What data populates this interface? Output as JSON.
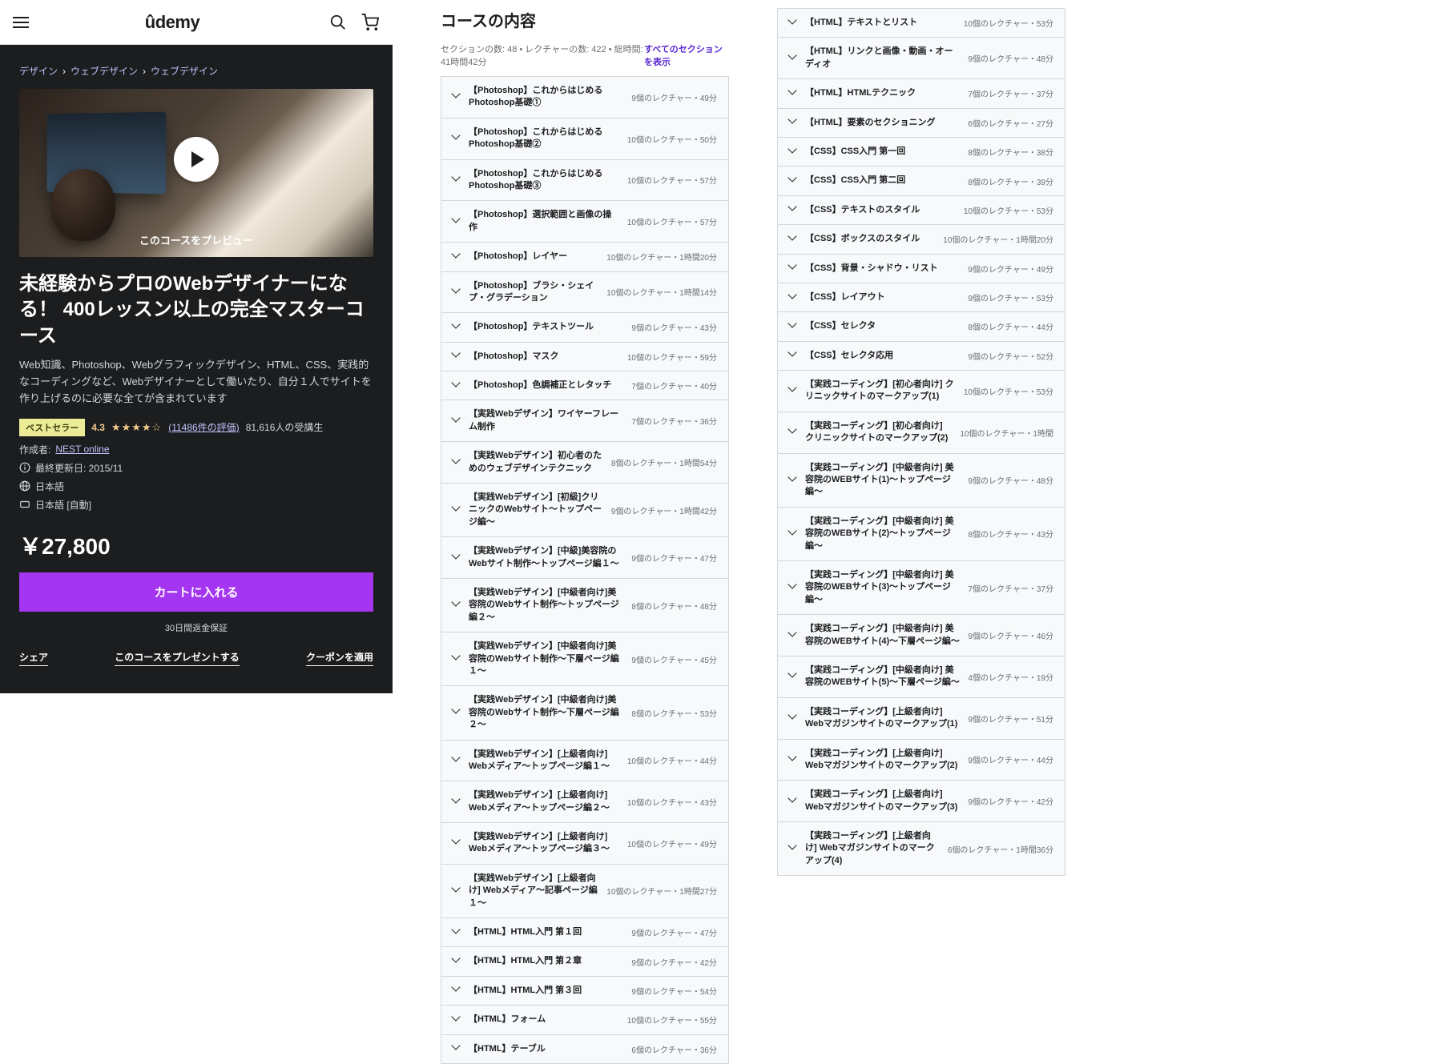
{
  "logo": "ûdemy",
  "breadcrumb": [
    "デザイン",
    "ウェブデザイン",
    "ウェブデザイン"
  ],
  "preview_label": "このコースをプレビュー",
  "title": "未経験からプロのWebデザイナーになる！ 400レッスン以上の完全マスターコース",
  "subtitle": "Web知識、Photoshop、Webグラフィックデザイン、HTML、CSS、実践的なコーディングなど、Webデザイナーとして働いたり、自分１人でサイトを作り上げるのに必要な全てが含まれています",
  "bestseller": "ベストセラー",
  "rating": "4.3",
  "stars": "★★★★☆",
  "reviews": "(11486件の評価)",
  "students": "81,616人の受講生",
  "creator_label": "作成者:",
  "creator": "NEST online",
  "updated": "最終更新日: 2015/11",
  "lang": "日本語",
  "cc": "日本語 [自動]",
  "price": "￥27,800",
  "add_to_cart": "カートに入れる",
  "guarantee": "30日間返金保証",
  "share": "シェア",
  "gift": "このコースをプレゼントする",
  "coupon": "クーポンを適用",
  "cc_title": "コースの内容",
  "cc_stats": "セクションの数: 48 • レクチャーの数: 422 • 総時間: 41時間42分",
  "cc_expand": "すべてのセクションを表示",
  "sections_a": [
    {
      "t": "【Photoshop】これからはじめるPhotoshop基礎①",
      "m": "9個のレクチャー・49分"
    },
    {
      "t": "【Photoshop】これからはじめるPhotoshop基礎②",
      "m": "10個のレクチャー・50分"
    },
    {
      "t": "【Photoshop】これからはじめるPhotoshop基礎③",
      "m": "10個のレクチャー・57分"
    },
    {
      "t": "【Photoshop】選択範囲と画像の操作",
      "m": "10個のレクチャー・57分"
    },
    {
      "t": "【Photoshop】レイヤー",
      "m": "10個のレクチャー・1時間20分"
    },
    {
      "t": "【Photoshop】ブラシ・シェイプ・グラデーション",
      "m": "10個のレクチャー・1時間14分"
    },
    {
      "t": "【Photoshop】テキストツール",
      "m": "9個のレクチャー・43分"
    },
    {
      "t": "【Photoshop】マスク",
      "m": "10個のレクチャー・59分"
    },
    {
      "t": "【Photoshop】色調補正とレタッチ",
      "m": "7個のレクチャー・40分"
    },
    {
      "t": "【実践Webデザイン】ワイヤーフレーム制作",
      "m": "7個のレクチャー・36分"
    },
    {
      "t": "【実践Webデザイン】初心者のためのウェブデザインテクニック",
      "m": "8個のレクチャー・1時間54分"
    },
    {
      "t": "【実践Webデザイン】[初級]クリニックのWebサイト〜トップページ編〜",
      "m": "9個のレクチャー・1時間42分"
    },
    {
      "t": "【実践Webデザイン】[中級]美容院のWebサイト制作〜トップページ編１〜",
      "m": "9個のレクチャー・47分"
    },
    {
      "t": "【実践Webデザイン】[中級者向け]美容院のWebサイト制作〜トップページ編２〜",
      "m": "8個のレクチャー・48分"
    },
    {
      "t": "【実践Webデザイン】[中級者向け]美容院のWebサイト制作〜下層ページ編１〜",
      "m": "9個のレクチャー・45分"
    },
    {
      "t": "【実践Webデザイン】[中級者向け]美容院のWebサイト制作〜下層ページ編２〜",
      "m": "8個のレクチャー・53分"
    },
    {
      "t": "【実践Webデザイン】[上級者向け] Webメディア〜トップページ編１〜",
      "m": "10個のレクチャー・44分"
    },
    {
      "t": "【実践Webデザイン】[上級者向け] Webメディア〜トップページ編２〜",
      "m": "10個のレクチャー・43分"
    },
    {
      "t": "【実践Webデザイン】[上級者向け] Webメディア〜トップページ編３〜",
      "m": "10個のレクチャー・49分"
    },
    {
      "t": "【実践Webデザイン】[上級者向け] Webメディア〜記事ページ編１〜",
      "m": "10個のレクチャー・1時間27分"
    },
    {
      "t": "【HTML】HTML入門 第１回",
      "m": "9個のレクチャー・47分"
    },
    {
      "t": "【HTML】HTML入門 第２章",
      "m": "9個のレクチャー・42分"
    },
    {
      "t": "【HTML】HTML入門 第３回",
      "m": "9個のレクチャー・54分"
    },
    {
      "t": "【HTML】フォーム",
      "m": "10個のレクチャー・55分"
    },
    {
      "t": "【HTML】テーブル",
      "m": "6個のレクチャー・36分"
    }
  ],
  "sections_b": [
    {
      "t": "【HTML】テキストとリスト",
      "m": "10個のレクチャー・53分"
    },
    {
      "t": "【HTML】リンクと画像・動画・オーディオ",
      "m": "9個のレクチャー・48分"
    },
    {
      "t": "【HTML】HTMLテクニック",
      "m": "7個のレクチャー・37分"
    },
    {
      "t": "【HTML】要素のセクショニング",
      "m": "6個のレクチャー・27分"
    },
    {
      "t": "【CSS】CSS入門 第一回",
      "m": "8個のレクチャー・38分"
    },
    {
      "t": "【CSS】CSS入門 第二回",
      "m": "8個のレクチャー・39分"
    },
    {
      "t": "【CSS】テキストのスタイル",
      "m": "10個のレクチャー・53分"
    },
    {
      "t": "【CSS】ボックスのスタイル",
      "m": "10個のレクチャー・1時間20分"
    },
    {
      "t": "【CSS】背景・シャドウ・リスト",
      "m": "9個のレクチャー・49分"
    },
    {
      "t": "【CSS】レイアウト",
      "m": "9個のレクチャー・53分"
    },
    {
      "t": "【CSS】セレクタ",
      "m": "8個のレクチャー・44分"
    },
    {
      "t": "【CSS】セレクタ応用",
      "m": "9個のレクチャー・52分"
    },
    {
      "t": "【実践コーディング】[初心者向け] クリニックサイトのマークアップ(1)",
      "m": "10個のレクチャー・53分"
    },
    {
      "t": "【実践コーディング】[初心者向け] クリニックサイトのマークアップ(2)",
      "m": "10個のレクチャー・1時間"
    },
    {
      "t": "【実践コーディング】[中級者向け] 美容院のWEBサイト(1)〜トップページ編〜",
      "m": "9個のレクチャー・48分"
    },
    {
      "t": "【実践コーディング】[中級者向け] 美容院のWEBサイト(2)〜トップページ編〜",
      "m": "8個のレクチャー・43分"
    },
    {
      "t": "【実践コーディング】[中級者向け] 美容院のWEBサイト(3)〜トップページ編〜",
      "m": "7個のレクチャー・37分"
    },
    {
      "t": "【実践コーディング】[中級者向け] 美容院のWEBサイト(4)〜下層ページ編〜",
      "m": "9個のレクチャー・46分"
    },
    {
      "t": "【実践コーディング】[中級者向け] 美容院のWEBサイト(5)〜下層ページ編〜",
      "m": "4個のレクチャー・19分"
    },
    {
      "t": "【実践コーディング】[上級者向け] Webマガジンサイトのマークアップ(1)",
      "m": "9個のレクチャー・51分"
    },
    {
      "t": "【実践コーディング】[上級者向け] Webマガジンサイトのマークアップ(2)",
      "m": "9個のレクチャー・44分"
    },
    {
      "t": "【実践コーディング】[上級者向け] Webマガジンサイトのマークアップ(3)",
      "m": "9個のレクチャー・42分"
    },
    {
      "t": "【実践コーディング】[上級者向け] Webマガジンサイトのマークアップ(4)",
      "m": "6個のレクチャー・1時間36分"
    }
  ]
}
